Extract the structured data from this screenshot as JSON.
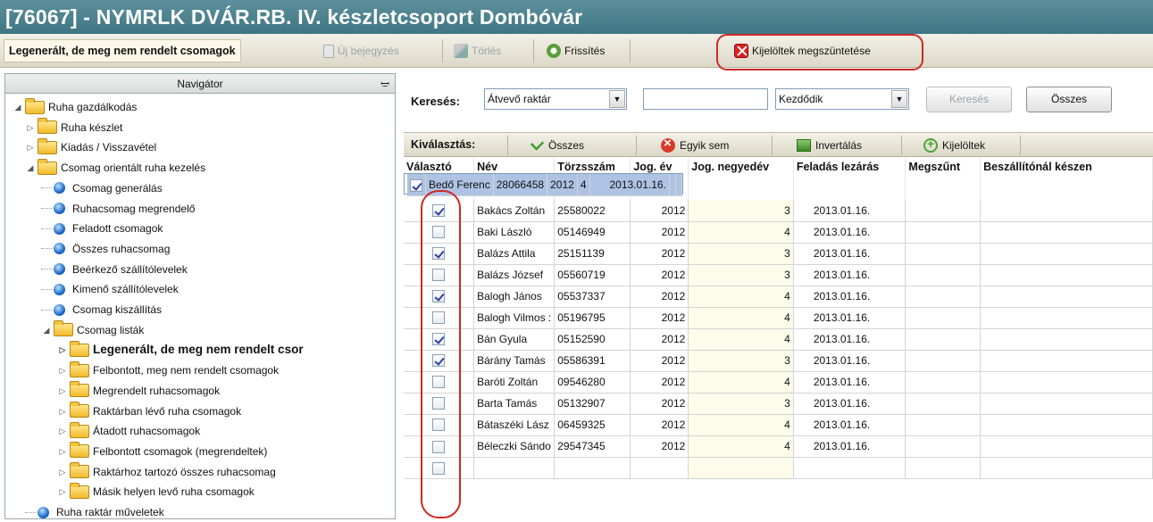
{
  "window": {
    "title": "[76067] - NYMRLK  DVÁR.RB. IV. készletcsoport Dombóvár"
  },
  "toolbar": {
    "active_view": "Legenerált, de meg nem rendelt csomagok",
    "new_entry": "Új bejegyzés",
    "delete": "Törlés",
    "refresh": "Frissítés",
    "clear_selection": "Kijelöltek megszüntetése"
  },
  "navigator": {
    "title": "Navigátor",
    "pin_icon": "pin-icon",
    "items": [
      {
        "label": "Ruha gazdálkodás",
        "type": "folder",
        "level": 0,
        "expanded": true
      },
      {
        "label": "Ruha készlet",
        "type": "folder",
        "level": 1,
        "expanded": false
      },
      {
        "label": "Kiadás / Visszavétel",
        "type": "folder",
        "level": 1,
        "expanded": false
      },
      {
        "label": "Csomag orientált ruha kezelés",
        "type": "folder",
        "level": 1,
        "expanded": true
      },
      {
        "label": "Csomag generálás",
        "type": "leaf",
        "level": 2
      },
      {
        "label": "Ruhacsomag megrendelő",
        "type": "leaf",
        "level": 2
      },
      {
        "label": "Feladott csomagok",
        "type": "leaf",
        "level": 2
      },
      {
        "label": "Összes ruhacsomag",
        "type": "leaf",
        "level": 2
      },
      {
        "label": "Beérkező szállítólevelek",
        "type": "leaf",
        "level": 2
      },
      {
        "label": "Kimenő szállítólevelek",
        "type": "leaf",
        "level": 2
      },
      {
        "label": "Csomag kiszállítás",
        "type": "leaf",
        "level": 2
      },
      {
        "label": "Csomag listák",
        "type": "folder",
        "level": 2,
        "expanded": true
      },
      {
        "label": "Legenerált, de meg nem rendelt csor",
        "type": "folder",
        "level": 3,
        "expanded": false,
        "selected": true
      },
      {
        "label": "Felbontott, meg nem rendelt csomagok",
        "type": "folder",
        "level": 3,
        "expanded": false
      },
      {
        "label": "Megrendelt ruhacsomagok",
        "type": "folder",
        "level": 3,
        "expanded": false
      },
      {
        "label": "Raktárban lévő ruha csomagok",
        "type": "folder",
        "level": 3,
        "expanded": false
      },
      {
        "label": "Átadott ruhacsomagok",
        "type": "folder",
        "level": 3,
        "expanded": false
      },
      {
        "label": "Felbontott csomagok (megrendeltek)",
        "type": "folder",
        "level": 3,
        "expanded": false
      },
      {
        "label": "Raktárhoz tartozó összes ruhacsomag",
        "type": "folder",
        "level": 3,
        "expanded": false
      },
      {
        "label": "Másik helyen levő ruha csomagok",
        "type": "folder",
        "level": 3,
        "expanded": false
      },
      {
        "label": "Ruha raktár műveletek",
        "type": "leaf",
        "level": 1
      }
    ]
  },
  "search": {
    "label": "Keresés:",
    "field": "Átvevő raktár",
    "value": "",
    "mode": "Kezdődik",
    "search_button": "Keresés",
    "all_button": "Összes"
  },
  "selection_bar": {
    "label": "Kiválasztás:",
    "all": "Összes",
    "none": "Egyik sem",
    "invert": "Invertálás",
    "selected": "Kijelöltek"
  },
  "table": {
    "columns": [
      "Választó",
      "Név",
      "Törzsszám",
      "Jog. év",
      "Jog. negyedév",
      "Feladás lezárás",
      "Megszűnt",
      "Beszállítónál készen"
    ],
    "rows": [
      {
        "checked": true,
        "name": "Bakács Zoltán",
        "id": "25580022",
        "year": "2012",
        "quarter": "3",
        "closed": "2013.01.16.",
        "ceased": "",
        "ready": ""
      },
      {
        "checked": false,
        "name": "Baki László",
        "id": "05146949",
        "year": "2012",
        "quarter": "4",
        "closed": "2013.01.16.",
        "ceased": "",
        "ready": ""
      },
      {
        "checked": true,
        "name": "Balázs Attila",
        "id": "25151139",
        "year": "2012",
        "quarter": "3",
        "closed": "2013.01.16.",
        "ceased": "",
        "ready": ""
      },
      {
        "checked": false,
        "name": "Balázs József",
        "id": "05560719",
        "year": "2012",
        "quarter": "3",
        "closed": "2013.01.16.",
        "ceased": "",
        "ready": ""
      },
      {
        "checked": true,
        "name": "Balogh János",
        "id": "05537337",
        "year": "2012",
        "quarter": "4",
        "closed": "2013.01.16.",
        "ceased": "",
        "ready": ""
      },
      {
        "checked": false,
        "name": "Balogh Vilmos :",
        "id": "05196795",
        "year": "2012",
        "quarter": "4",
        "closed": "2013.01.16.",
        "ceased": "",
        "ready": ""
      },
      {
        "checked": true,
        "name": "Bán Gyula",
        "id": "05152590",
        "year": "2012",
        "quarter": "4",
        "closed": "2013.01.16.",
        "ceased": "",
        "ready": ""
      },
      {
        "checked": true,
        "name": "Bárány Tamás",
        "id": "05586391",
        "year": "2012",
        "quarter": "3",
        "closed": "2013.01.16.",
        "ceased": "",
        "ready": ""
      },
      {
        "checked": false,
        "name": "Baróti Zoltán",
        "id": "09546280",
        "year": "2012",
        "quarter": "4",
        "closed": "2013.01.16.",
        "ceased": "",
        "ready": ""
      },
      {
        "checked": false,
        "name": "Barta Tamás",
        "id": "05132907",
        "year": "2012",
        "quarter": "3",
        "closed": "2013.01.16.",
        "ceased": "",
        "ready": ""
      },
      {
        "checked": false,
        "name": "Bátaszéki Lász",
        "id": "06459325",
        "year": "2012",
        "quarter": "4",
        "closed": "2013.01.16.",
        "ceased": "",
        "ready": ""
      },
      {
        "checked": true,
        "name": "Bedő Ferenc",
        "id": "28066458",
        "year": "2012",
        "quarter": "4",
        "closed": "2013.01.16.",
        "ceased": "",
        "ready": "",
        "selected": true
      },
      {
        "checked": false,
        "name": "Béleczki Sándo",
        "id": "29547345",
        "year": "2012",
        "quarter": "4",
        "closed": "2013.01.16.",
        "ceased": "",
        "ready": ""
      },
      {
        "checked": false,
        "name": "",
        "id": "",
        "year": "",
        "quarter": "",
        "closed": "",
        "ceased": "",
        "ready": ""
      }
    ]
  },
  "colors": {
    "title_bar": "#4a8290",
    "highlight": "#cf2a25",
    "selected_row": "#aec2e4",
    "alt_cell": "#fdfbe9"
  }
}
